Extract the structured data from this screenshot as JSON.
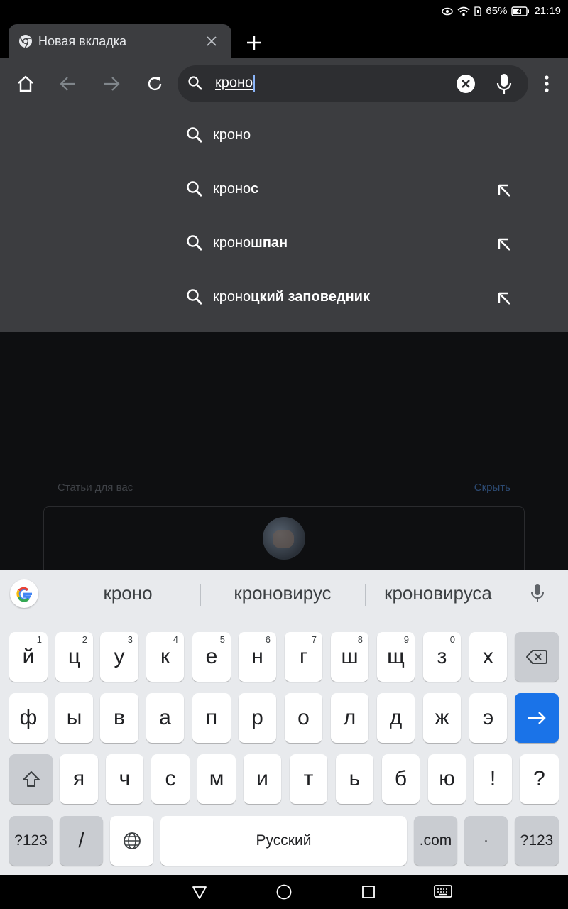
{
  "status": {
    "battery_percent": "65%",
    "time": "21:19"
  },
  "tab": {
    "title": "Новая вкладка"
  },
  "omnibox": {
    "text": "кроно"
  },
  "suggestions": [
    {
      "prefix": "кроно",
      "suffix": "",
      "has_arrow": false
    },
    {
      "prefix": "кроно",
      "suffix": "с",
      "has_arrow": true
    },
    {
      "prefix": "кроно",
      "suffix": "шпан",
      "has_arrow": true
    },
    {
      "prefix": "кроно",
      "suffix": "цкий заповедник",
      "has_arrow": true
    }
  ],
  "content": {
    "articles_label": "Статьи для вас",
    "hide_label": "Скрыть"
  },
  "keyboard": {
    "suggestions": [
      "кроно",
      "кроновирус",
      "кроновируса"
    ],
    "row1": [
      {
        "label": "й",
        "hint": "1"
      },
      {
        "label": "ц",
        "hint": "2"
      },
      {
        "label": "у",
        "hint": "3"
      },
      {
        "label": "к",
        "hint": "4"
      },
      {
        "label": "е",
        "hint": "5"
      },
      {
        "label": "н",
        "hint": "6"
      },
      {
        "label": "г",
        "hint": "7"
      },
      {
        "label": "ш",
        "hint": "8"
      },
      {
        "label": "щ",
        "hint": "9"
      },
      {
        "label": "з",
        "hint": "0"
      },
      {
        "label": "х",
        "hint": ""
      }
    ],
    "row2": [
      "ф",
      "ы",
      "в",
      "а",
      "п",
      "р",
      "о",
      "л",
      "д",
      "ж",
      "э"
    ],
    "row3": [
      "я",
      "ч",
      "с",
      "м",
      "и",
      "т",
      "ь",
      "б",
      "ю",
      "!",
      "?"
    ],
    "symbols_label": "?123",
    "slash_label": "/",
    "space_label": "Русский",
    "dotcom_label": ".com",
    "period_label": "·",
    "symbols_label_right": "?123"
  }
}
